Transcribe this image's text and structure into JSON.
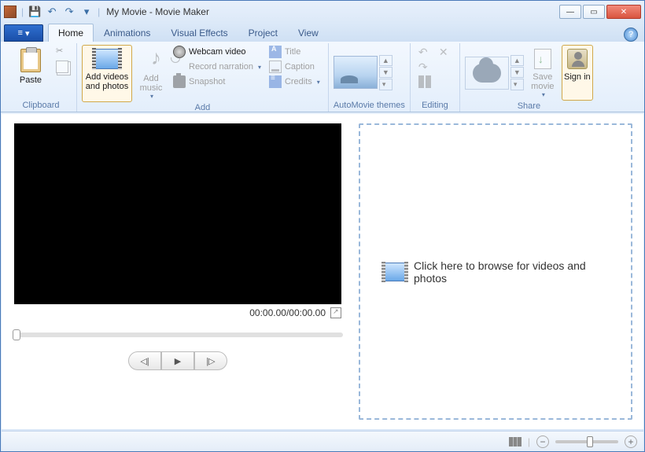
{
  "titlebar": {
    "title": "My Movie - Movie Maker"
  },
  "tabs": {
    "file_icon": "≡",
    "items": [
      "Home",
      "Animations",
      "Visual Effects",
      "Project",
      "View"
    ],
    "active": "Home"
  },
  "ribbon": {
    "clipboard": {
      "label": "Clipboard",
      "paste": "Paste"
    },
    "add": {
      "label": "Add",
      "add_videos": "Add videos and photos",
      "add_music": "Add music",
      "webcam": "Webcam video",
      "record_narration": "Record narration",
      "snapshot": "Snapshot",
      "title": "Title",
      "caption": "Caption",
      "credits": "Credits"
    },
    "automovie": {
      "label": "AutoMovie themes"
    },
    "editing": {
      "label": "Editing"
    },
    "share": {
      "label": "Share",
      "save_movie": "Save movie",
      "sign_in": "Sign in"
    }
  },
  "preview": {
    "timecode": "00:00.00/00:00.00"
  },
  "storyboard": {
    "prompt": "Click here to browse for videos and photos"
  }
}
